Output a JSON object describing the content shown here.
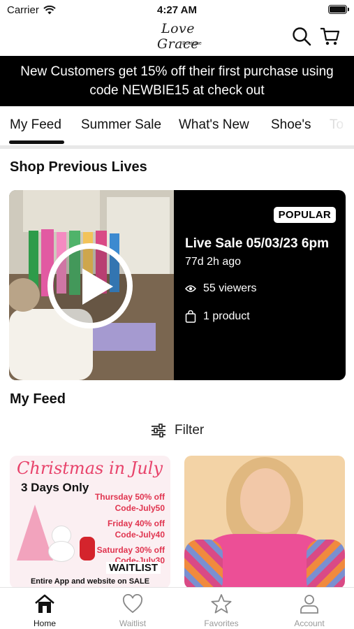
{
  "status_bar": {
    "carrier": "Carrier",
    "time": "4:27 AM",
    "battery_level": 1.0
  },
  "header": {
    "logo_text": "Love Grace",
    "logo_subtext": "Boutique",
    "icons": [
      "search-icon",
      "cart-icon"
    ]
  },
  "promo_banner": {
    "line1": "New Customers get 15% off their first purchase using",
    "line2": "code NEWBIE15 at check out"
  },
  "tabs": [
    {
      "label": "My Feed",
      "active": true
    },
    {
      "label": "Summer Sale"
    },
    {
      "label": "What's New"
    },
    {
      "label": "Shoe's"
    },
    {
      "label": "To"
    }
  ],
  "shop_previous_lives": {
    "title": "Shop Previous Lives",
    "card": {
      "badge": "POPULAR",
      "title": "Live Sale 05/03/23 6pm",
      "ago": "77d 2h ago",
      "viewers": "55 viewers",
      "products": "1 product"
    }
  },
  "my_feed": {
    "title": "My Feed",
    "filter_label": "Filter",
    "promo_card": {
      "script": "Christmas in July",
      "days": "3 Days Only",
      "line1": "Thursday 50% off",
      "line2": "Code-July50",
      "line3": "Friday 40% off",
      "line4": "Code-July40",
      "line5": "Saturday 30% off",
      "line6": "Code-July30",
      "waitlist": "WAITLIST",
      "footer": "Entire App and website on SALE"
    }
  },
  "bottom_nav": [
    {
      "label": "Home",
      "icon": "home-icon",
      "active": true
    },
    {
      "label": "Waitlist",
      "icon": "heart-icon"
    },
    {
      "label": "Favorites",
      "icon": "star-icon"
    },
    {
      "label": "Account",
      "icon": "account-icon"
    }
  ],
  "colors": {
    "accent": "#000000",
    "promo_pink": "#e0344f",
    "inactive_nav": "#999999"
  }
}
